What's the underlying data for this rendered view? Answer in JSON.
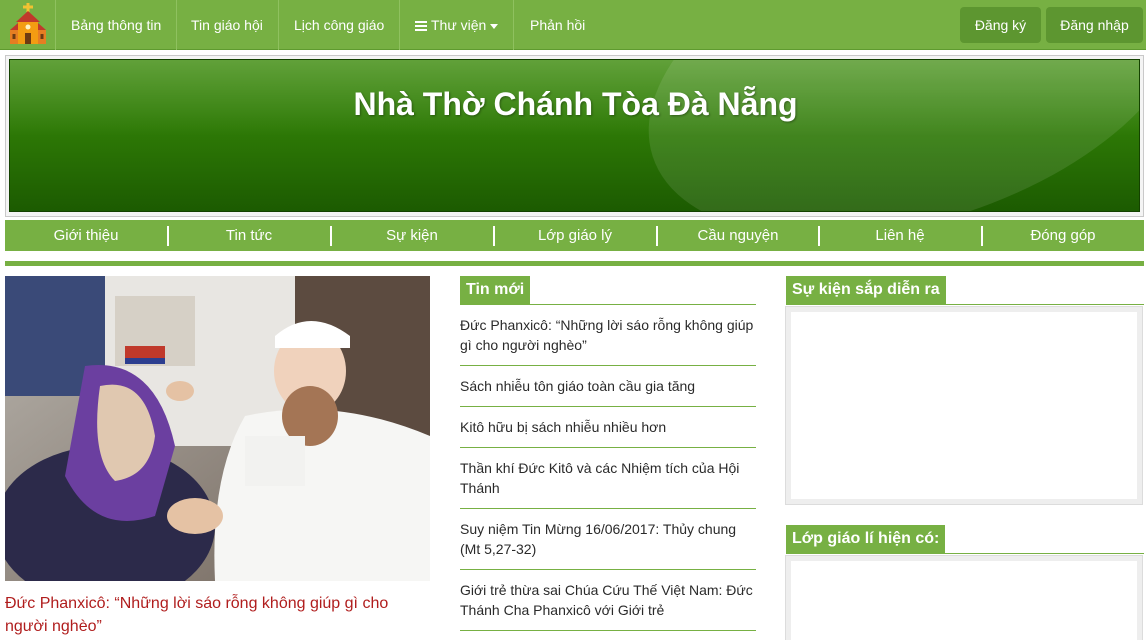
{
  "topnav": {
    "items": [
      {
        "label": "Bảng thông tin"
      },
      {
        "label": "Tin giáo hội"
      },
      {
        "label": "Lịch công giáo"
      },
      {
        "label": "Thư viện"
      },
      {
        "label": "Phản hồi"
      }
    ],
    "register_label": "Đăng ký",
    "login_label": "Đăng nhập"
  },
  "banner": {
    "title": "Nhà Thờ Chánh Tòa Đà Nẵng"
  },
  "subnav": {
    "items": [
      {
        "label": "Giới thiệu"
      },
      {
        "label": "Tin tức"
      },
      {
        "label": "Sự kiện"
      },
      {
        "label": "Lớp giáo lý"
      },
      {
        "label": "Cầu nguyện"
      },
      {
        "label": "Liên hệ"
      },
      {
        "label": "Đóng góp"
      }
    ]
  },
  "featured": {
    "caption": "Đức Phanxicô: “Những lời sáo rỗng không giúp gì cho người nghèo”"
  },
  "news": {
    "heading": "Tin mới",
    "items": [
      {
        "title": "Đức Phanxicô: “Những lời sáo rỗng không giúp gì cho người nghèo”"
      },
      {
        "title": "Sách nhiễu tôn giáo toàn cầu gia tăng"
      },
      {
        "title": "Kitô hữu bị sách nhiễu nhiều hơn"
      },
      {
        "title": "Thần khí Đức Kitô và các Nhiệm tích của Hội Thánh"
      },
      {
        "title": "Suy niệm Tin Mừng 16/06/2017: Thủy chung (Mt 5,27-32)"
      },
      {
        "title": "Giới trẻ thừa sai Chúa Cứu Thế Việt Nam: Đức Thánh Cha Phanxicô với Giới trẻ"
      }
    ]
  },
  "sidebar": {
    "events_heading": "Sự kiện sắp diễn ra",
    "classes_heading": "Lớp giáo lí hiện có:"
  },
  "colors": {
    "brand_green": "#77b043",
    "banner_green": "#2e7a06",
    "caption_red": "#b01d1d"
  }
}
